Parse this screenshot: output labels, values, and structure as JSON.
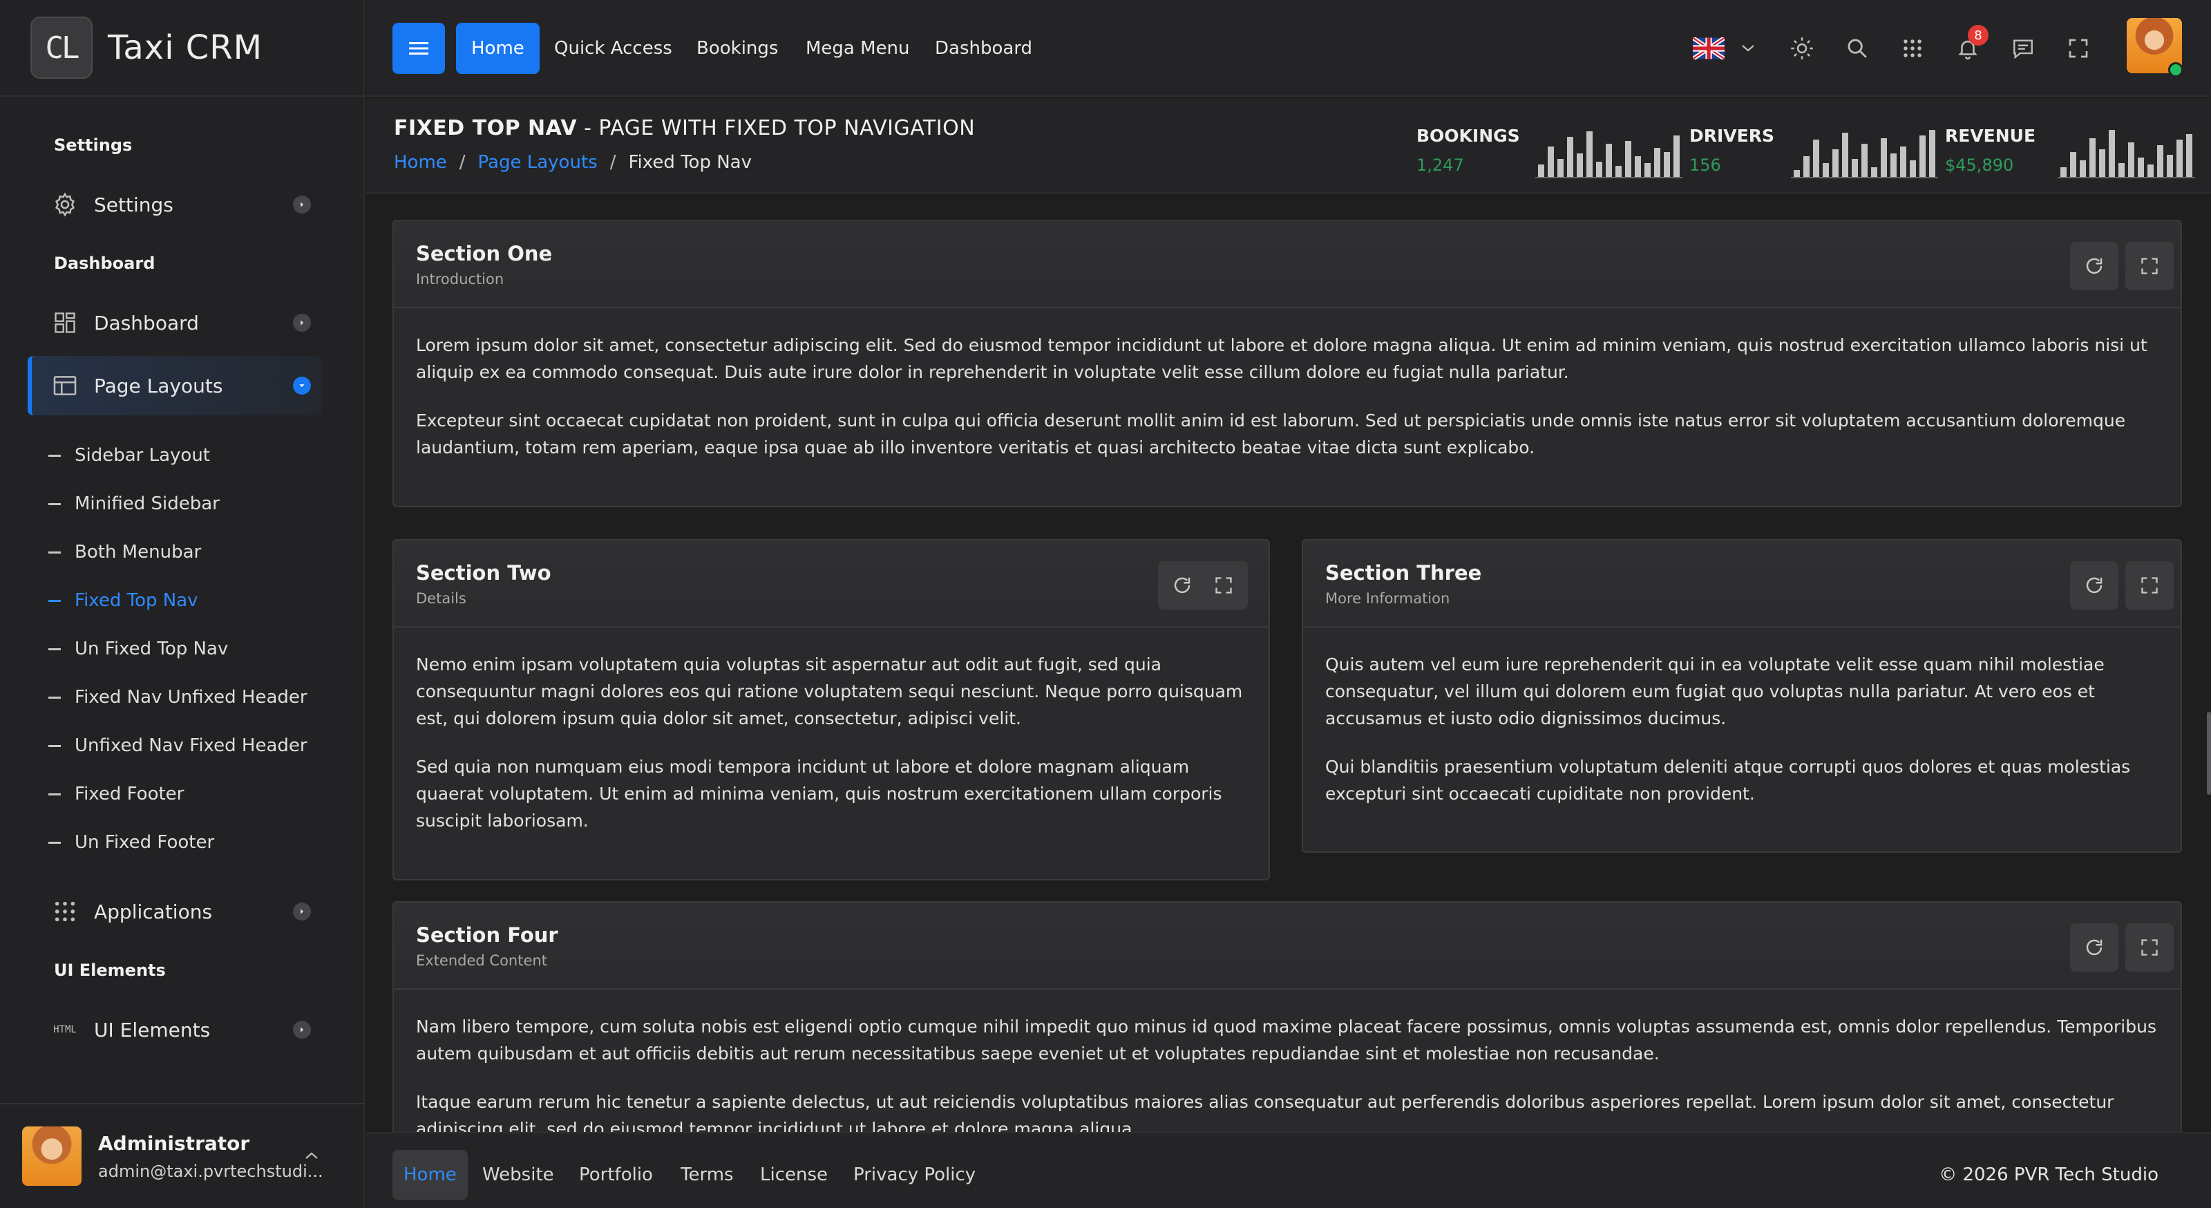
{
  "brand": {
    "logo_text": "CL",
    "name": "Taxi CRM"
  },
  "sidebar": {
    "sections": [
      "Settings",
      "Dashboard",
      "UI Elements"
    ],
    "items": {
      "settings": "Settings",
      "dashboard": "Dashboard",
      "page_layouts": "Page Layouts",
      "applications": "Applications",
      "ui_elements": "UI Elements"
    },
    "sub_items": [
      "Sidebar Layout",
      "Minified Sidebar",
      "Both Menubar",
      "Fixed Top Nav",
      "Un Fixed Top Nav",
      "Fixed Nav Unfixed Header",
      "Unfixed Nav Fixed Header",
      "Fixed Footer",
      "Un Fixed Footer"
    ],
    "html_icon_text": "HTML",
    "user": {
      "name": "Administrator",
      "email": "admin@taxi.pvrtechstudi..."
    }
  },
  "topbar": {
    "links": [
      "Home",
      "Quick Access",
      "Bookings",
      "Mega Menu",
      "Dashboard"
    ],
    "notification_count": "8",
    "icons": [
      "menu-icon",
      "uk-flag-icon",
      "chevron-down-icon",
      "sun-icon",
      "search-icon",
      "apps-grid-icon",
      "bell-icon",
      "chat-icon",
      "fullscreen-icon"
    ]
  },
  "page_header": {
    "title_bold": "FIXED TOP NAV",
    "title_rest": " - PAGE WITH FIXED TOP NAVIGATION",
    "breadcrumb": [
      "Home",
      "Page Layouts",
      "Fixed Top Nav"
    ],
    "breadcrumb_sep": "/",
    "stats": [
      {
        "label": "BOOKINGS",
        "value": "1,247"
      },
      {
        "label": "DRIVERS",
        "value": "156"
      },
      {
        "label": "REVENUE",
        "value": "$45,890"
      }
    ],
    "stat_color": "#2e9b5c"
  },
  "sections": {
    "one": {
      "title": "Section One",
      "subtitle": "Introduction",
      "paragraphs": [
        "Lorem ipsum dolor sit amet, consectetur adipiscing elit. Sed do eiusmod tempor incididunt ut labore et dolore magna aliqua. Ut enim ad minim veniam, quis nostrud exercitation ullamco laboris nisi ut aliquip ex ea commodo consequat. Duis aute irure dolor in reprehenderit in voluptate velit esse cillum dolore eu fugiat nulla pariatur.",
        "Excepteur sint occaecat cupidatat non proident, sunt in culpa qui officia deserunt mollit anim id est laborum. Sed ut perspiciatis unde omnis iste natus error sit voluptatem accusantium doloremque laudantium, totam rem aperiam, eaque ipsa quae ab illo inventore veritatis et quasi architecto beatae vitae dicta sunt explicabo."
      ]
    },
    "two": {
      "title": "Section Two",
      "subtitle": "Details",
      "paragraphs": [
        "Nemo enim ipsam voluptatem quia voluptas sit aspernatur aut odit aut fugit, sed quia consequuntur magni dolores eos qui ratione voluptatem sequi nesciunt. Neque porro quisquam est, qui dolorem ipsum quia dolor sit amet, consectetur, adipisci velit.",
        "Sed quia non numquam eius modi tempora incidunt ut labore et dolore magnam aliquam quaerat voluptatem. Ut enim ad minima veniam, quis nostrum exercitationem ullam corporis suscipit laboriosam."
      ]
    },
    "three": {
      "title": "Section Three",
      "subtitle": "More Information",
      "paragraphs": [
        "Quis autem vel eum iure reprehenderit qui in ea voluptate velit esse quam nihil molestiae consequatur, vel illum qui dolorem eum fugiat quo voluptas nulla pariatur. At vero eos et accusamus et iusto odio dignissimos ducimus.",
        "Qui blanditiis praesentium voluptatum deleniti atque corrupti quos dolores et quas molestias excepturi sint occaecati cupiditate non provident."
      ]
    },
    "four": {
      "title": "Section Four",
      "subtitle": "Extended Content",
      "paragraphs": [
        "Nam libero tempore, cum soluta nobis est eligendi optio cumque nihil impedit quo minus id quod maxime placeat facere possimus, omnis voluptas assumenda est, omnis dolor repellendus. Temporibus autem quibusdam et aut officiis debitis aut rerum necessitatibus saepe eveniet ut et voluptates repudiandae sint et molestiae non recusandae.",
        "Itaque earum rerum hic tenetur a sapiente delectus, ut aut reiciendis voluptatibus maiores alias consequatur aut perferendis doloribus asperiores repellat. Lorem ipsum dolor sit amet, consectetur adipiscing elit, sed do eiusmod tempor incididunt ut labore et dolore magna aliqua."
      ]
    }
  },
  "footer": {
    "links": [
      "Home",
      "Website",
      "Portfolio",
      "Terms",
      "License",
      "Privacy Policy"
    ],
    "copyright": "© 2026  PVR Tech Studio"
  },
  "colors": {
    "accent": "#1877f2",
    "link": "#2f8bff",
    "badge": "#e53935",
    "online": "#20c05c"
  }
}
